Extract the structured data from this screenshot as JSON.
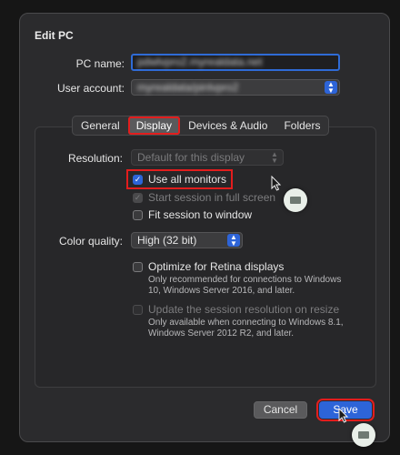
{
  "dialog": {
    "title": "Edit PC",
    "pc_name": {
      "label": "PC name:",
      "value": "pdwlvpro2.myrealdata.net"
    },
    "user_account": {
      "label": "User account:",
      "value": "myrealdata/pinlvpro2"
    }
  },
  "tabs": [
    "General",
    "Display",
    "Devices & Audio",
    "Folders"
  ],
  "active_tab": "Display",
  "display": {
    "resolution": {
      "label": "Resolution:",
      "value": "Default for this display"
    },
    "use_all_monitors": {
      "label": "Use all monitors",
      "checked": true
    },
    "start_full_screen": {
      "label": "Start session in full screen",
      "checked": true,
      "disabled": true
    },
    "fit_to_window": {
      "label": "Fit session to window",
      "checked": false
    },
    "color_quality": {
      "label": "Color quality:",
      "value": "High (32 bit)"
    },
    "retina": {
      "label": "Optimize for Retina displays",
      "checked": false,
      "note_line1": "Only recommended for connections to Windows",
      "note_line2": "10, Windows Server 2016, and later."
    },
    "update_on_resize": {
      "label": "Update the session resolution on resize",
      "checked": false,
      "disabled": true,
      "note_line1": "Only available when connecting to Windows 8.1,",
      "note_line2": "Windows Server 2012 R2, and later."
    }
  },
  "buttons": {
    "cancel": "Cancel",
    "save": "Save"
  },
  "colors": {
    "accent": "#2d64d8",
    "highlight": "#e21d1d",
    "background": "#2b2b2d"
  }
}
